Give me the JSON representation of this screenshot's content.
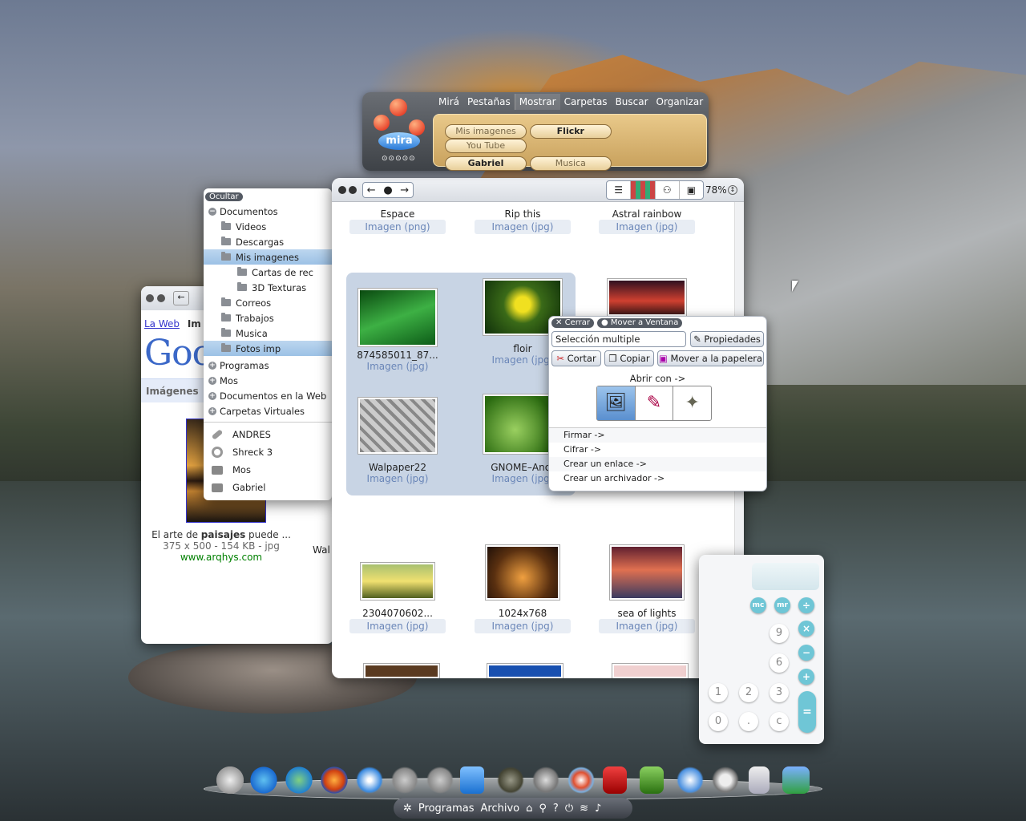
{
  "mira": {
    "menu": [
      "Mirá",
      "Pestañas",
      "Mostrar",
      "Carpetas",
      "Buscar",
      "Organizar"
    ],
    "tabs": [
      "Mis imagenes",
      "Flickr",
      "You Tube",
      "Gabriel",
      "Musica"
    ],
    "logo": "mira"
  },
  "sidebar": {
    "hide": "Ocultar",
    "items": [
      "Documentos",
      "Videos",
      "Descargas",
      "Mis imagenes",
      "Cartas de rec",
      "3D Texturas",
      "Correos",
      "Trabajos",
      "Musica",
      "Fotos imp"
    ],
    "groups": [
      "Programas",
      "Mos",
      "Documentos en la Web",
      "Carpetas Virtuales"
    ],
    "devices": [
      "ANDRES",
      "Shreck 3",
      "Mos",
      "Gabriel"
    ]
  },
  "google": {
    "tab_web": "La Web",
    "tab_im": "Im",
    "logo": "Goo",
    "section": "Imágenes",
    "caption_pre": "El arte de ",
    "caption_bold": "paisajes",
    "caption_post": " puede ...",
    "meta": "375 x 500 - 154 KB - jpg",
    "url": "www.arqhys.com",
    "cut": "Wal"
  },
  "files": {
    "zoom": "78%",
    "tiles": [
      {
        "name": "Espace",
        "type": "Imagen (png)"
      },
      {
        "name": "Rip this",
        "type": "Imagen (jpg)"
      },
      {
        "name": "Astral rainbow",
        "type": "Imagen (jpg)"
      },
      {
        "name": "874585011_87...",
        "type": "Imagen (jpg)"
      },
      {
        "name": "floir",
        "type": "Imagen (jpg)"
      },
      {
        "name": "Walpaper22",
        "type": "Imagen (jpg)"
      },
      {
        "name": "GNOME–Anot",
        "type": "Imagen (jpg)"
      },
      {
        "name": "2304070602...",
        "type": "Imagen (jpg)"
      },
      {
        "name": "1024x768",
        "type": "Imagen (jpg)"
      },
      {
        "name": "sea of lights",
        "type": "Imagen (jpg)"
      }
    ]
  },
  "popup": {
    "close": "Cerrar",
    "move": "Mover a Ventana",
    "field": "Selección multiple",
    "props": "Propiedades",
    "cut": "Cortar",
    "copy": "Copiar",
    "trash": "Mover a la papelera",
    "open_with": "Abrir con ->",
    "actions": [
      "Firmar ->",
      "Cifrar ->",
      "Crear un enlace ->",
      "Crear un archivador ->"
    ]
  },
  "calc": {
    "keys": [
      "mc",
      "mr",
      "÷",
      "9",
      "×",
      "6",
      "−",
      "+",
      "1",
      "2",
      "3",
      "=",
      "0",
      ".",
      "c"
    ]
  },
  "taskbar": {
    "programs": "Programas",
    "archive": "Archivo"
  }
}
